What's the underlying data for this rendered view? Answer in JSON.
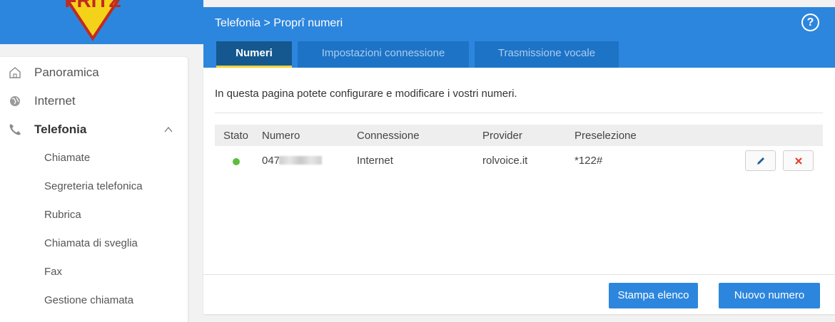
{
  "sidebar": {
    "items": [
      {
        "label": "Panoramica",
        "icon": "home-icon"
      },
      {
        "label": "Internet",
        "icon": "globe-icon"
      },
      {
        "label": "Telefonia",
        "icon": "phone-icon"
      }
    ],
    "subitems": [
      "Chiamate",
      "Segreteria telefonica",
      "Rubrica",
      "Chiamata di sveglia",
      "Fax",
      "Gestione chiamata"
    ]
  },
  "header": {
    "breadcrumb": "Telefonia > Proprî numeri",
    "help": "?",
    "tabs": [
      "Numeri",
      "Impostazioni connessione",
      "Trasmissione vocale"
    ]
  },
  "main": {
    "intro": "In questa pagina potete configurare e modificare i vostri numeri.",
    "columns": [
      "Stato",
      "Numero",
      "Connessione",
      "Provider",
      "Preselezione"
    ],
    "rows": [
      {
        "numero": "047",
        "connessione": "Internet",
        "provider": "rolvoice.it",
        "preselezione": "*122#",
        "status_color": "#5bbf3a"
      }
    ],
    "buttons": {
      "print": "Stampa elenco",
      "new": "Nuovo numero"
    }
  },
  "colors": {
    "accent": "#2d86dd",
    "active_tab": "#14588f",
    "tab_underline": "#f2d23a",
    "delete": "#e5412d"
  }
}
